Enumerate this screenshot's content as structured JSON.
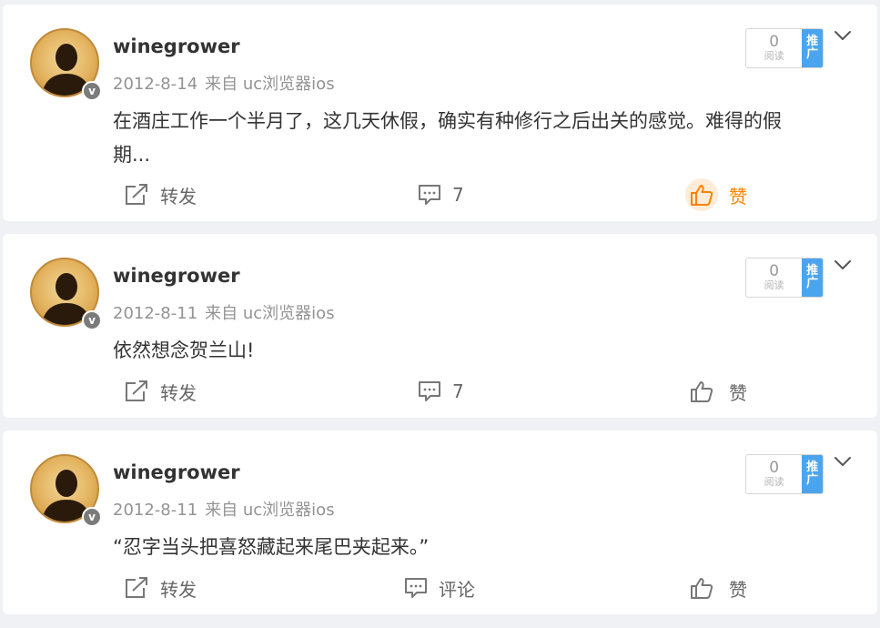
{
  "posts": [
    {
      "username": "winegrower",
      "date": "2012-8-14",
      "source": "来自 uc浏览器ios",
      "verified_badge": "v",
      "text_line1": "在酒庄工作一个半月了，这几天休假，确实有种修行之后出关的感觉。难得的假",
      "text_line2": "期...",
      "promo_count": "0",
      "promo_count_label": "阅读",
      "promo_tag_line1": "推",
      "promo_tag_line2": "广",
      "forward_label": "转发",
      "comment_label": "7",
      "like_label": "赞",
      "liked": true
    },
    {
      "username": "winegrower",
      "date": "2012-8-11",
      "source": "来自 uc浏览器ios",
      "verified_badge": "v",
      "text_line1": "依然想念贺兰山!",
      "promo_count": "0",
      "promo_count_label": "阅读",
      "promo_tag_line1": "推",
      "promo_tag_line2": "广",
      "forward_label": "转发",
      "comment_label": "7",
      "like_label": "赞",
      "liked": false
    },
    {
      "username": "winegrower",
      "date": "2012-8-11",
      "source": "来自 uc浏览器ios",
      "verified_badge": "v",
      "text_line1": "“忍字当头把喜怒藏起来尾巴夹起来。”",
      "promo_count": "0",
      "promo_count_label": "阅读",
      "promo_tag_line1": "推",
      "promo_tag_line2": "广",
      "forward_label": "转发",
      "comment_label": "评论",
      "like_label": "赞",
      "liked": false
    }
  ],
  "colors": {
    "like_active": "#ff8200",
    "promo_tag": "#4ba5ee",
    "meta_text": "#939393"
  },
  "icons": [
    "avatar-silhouette",
    "verified-icon",
    "chevron-down-icon",
    "forward-icon",
    "comment-icon",
    "like-icon"
  ]
}
